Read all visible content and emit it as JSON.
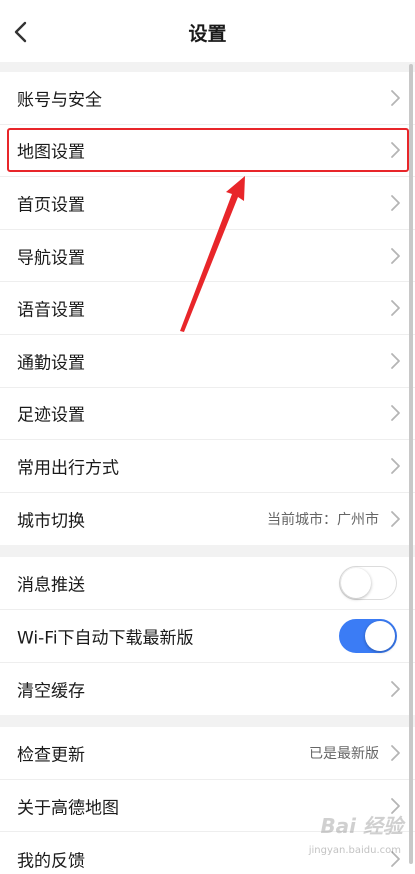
{
  "header": {
    "title": "设置",
    "back_icon": "chevron-left-icon"
  },
  "groups": [
    {
      "rows": [
        {
          "label": "账号与安全",
          "trailing": "chevron"
        },
        {
          "label": "地图设置",
          "trailing": "chevron",
          "highlighted": true
        },
        {
          "label": "首页设置",
          "trailing": "chevron"
        },
        {
          "label": "导航设置",
          "trailing": "chevron"
        },
        {
          "label": "语音设置",
          "trailing": "chevron"
        },
        {
          "label": "通勤设置",
          "trailing": "chevron"
        },
        {
          "label": "足迹设置",
          "trailing": "chevron"
        },
        {
          "label": "常用出行方式",
          "trailing": "chevron"
        },
        {
          "label": "城市切换",
          "value": "当前城市：广州市",
          "trailing": "chevron"
        }
      ]
    },
    {
      "rows": [
        {
          "label": "消息推送",
          "trailing": "toggle",
          "toggle_on": false
        },
        {
          "label": "Wi-Fi下自动下载最新版",
          "trailing": "toggle",
          "toggle_on": true
        },
        {
          "label": "清空缓存",
          "trailing": "chevron"
        }
      ]
    },
    {
      "rows": [
        {
          "label": "检查更新",
          "value": "已是最新版",
          "trailing": "chevron"
        },
        {
          "label": "关于高德地图",
          "trailing": "chevron"
        },
        {
          "label": "我的反馈",
          "trailing": "chevron"
        }
      ]
    }
  ],
  "colors": {
    "toggle_on": "#3b7cf5",
    "annotation_red": "#e8262a",
    "background": "#f2f2f2"
  },
  "watermark": {
    "logo_text": "Bai 经验",
    "url": "jingyan.baidu.com"
  }
}
